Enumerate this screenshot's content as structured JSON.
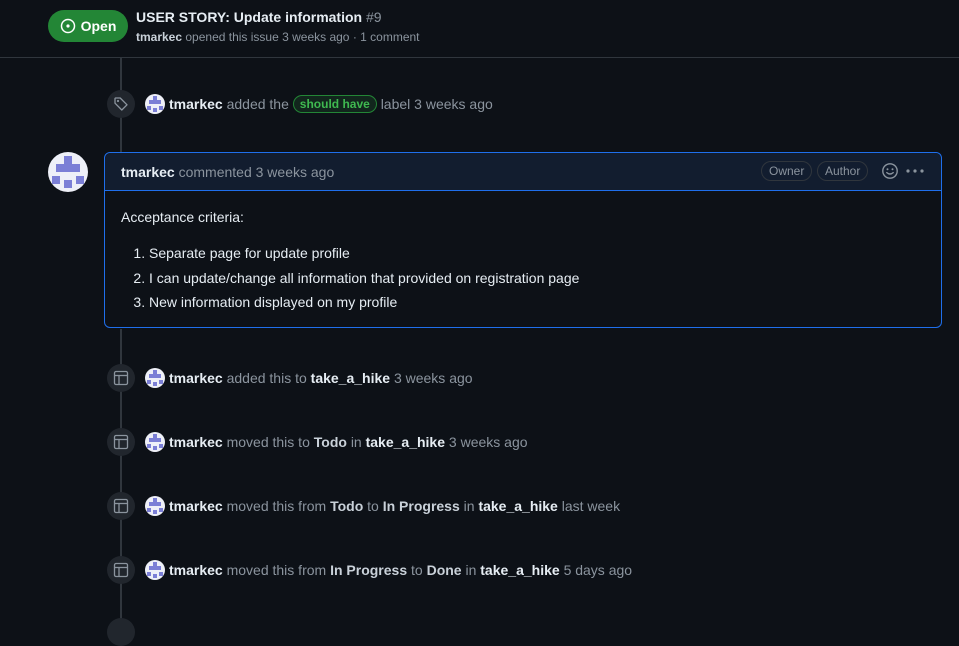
{
  "header": {
    "status": "Open",
    "title": "USER STORY: Update information",
    "number": "#9",
    "author": "tmarkec",
    "meta_rest": "opened this issue 3 weeks ago · 1 comment"
  },
  "events": {
    "label_event": {
      "user": "tmarkec",
      "prefix": "added the",
      "label": "should have",
      "suffix": "label 3 weeks ago",
      "icon": "tag-icon"
    },
    "project_added": {
      "user": "tmarkec",
      "prefix": "added this to",
      "project": "take_a_hike",
      "suffix": "3 weeks ago",
      "icon": "table-icon"
    },
    "moved_todo": {
      "user": "tmarkec",
      "prefix": "moved this to",
      "column": "Todo",
      "in": "in",
      "project": "take_a_hike",
      "suffix": "3 weeks ago"
    },
    "moved_progress": {
      "user": "tmarkec",
      "prefix": "moved this from",
      "from": "Todo",
      "to_word": "to",
      "to": "In Progress",
      "in": "in",
      "project": "take_a_hike",
      "suffix": "last week"
    },
    "moved_done": {
      "user": "tmarkec",
      "prefix": "moved this from",
      "from": "In Progress",
      "to_word": "to",
      "to": "Done",
      "in": "in",
      "project": "take_a_hike",
      "suffix": "5 days ago"
    }
  },
  "comment": {
    "author": "tmarkec",
    "action": "commented 3 weeks ago",
    "roles": [
      "Owner",
      "Author"
    ],
    "intro": "Acceptance criteria:",
    "criteria": [
      "Separate page for update profile",
      "I can update/change all information that provided on registration page",
      "New information displayed on my profile"
    ]
  },
  "colors": {
    "background": "#0d1117",
    "open_green": "#238636",
    "label_green": "#3fb950",
    "comment_border": "#1f6feb",
    "avatar_purple": "#7b7fd6"
  }
}
